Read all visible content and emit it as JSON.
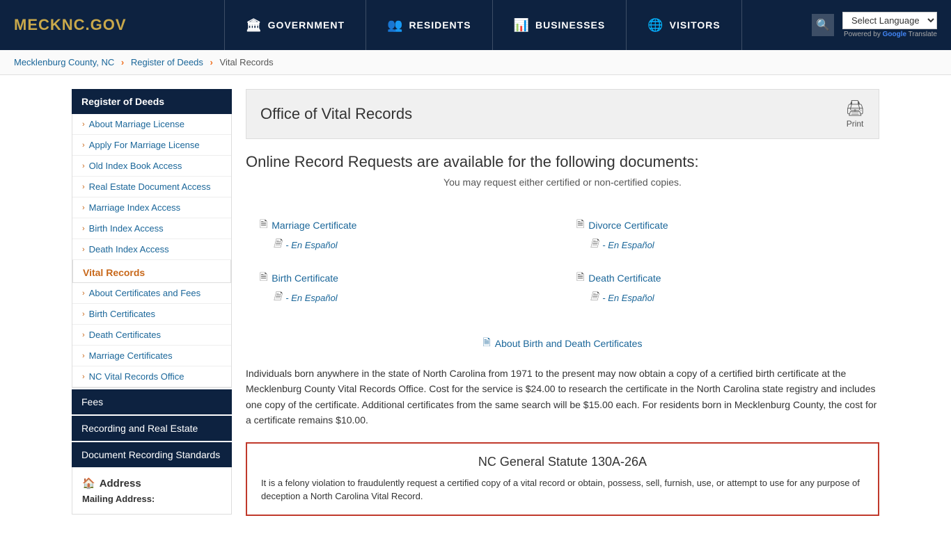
{
  "header": {
    "logo": {
      "prefix": "MECK",
      "suffix": "NC.GOV"
    },
    "nav": [
      {
        "label": "GOVERNMENT",
        "icon": "🏛"
      },
      {
        "label": "RESIDENTS",
        "icon": "👥"
      },
      {
        "label": "BUSINESSES",
        "icon": "📊"
      },
      {
        "label": "VISITORS",
        "icon": "🌐"
      }
    ],
    "translate_label": "Select Language",
    "powered_by": "Powered by",
    "google_text": "Google",
    "translate_text": "Translate"
  },
  "breadcrumb": {
    "items": [
      {
        "label": "Mecklenburg County, NC",
        "href": "#"
      },
      {
        "label": "Register of Deeds",
        "href": "#"
      },
      {
        "label": "Vital Records"
      }
    ]
  },
  "sidebar": {
    "register_header": "Register of Deeds",
    "register_links": [
      {
        "label": "About Marriage License"
      },
      {
        "label": "Apply For Marriage License"
      },
      {
        "label": "Old Index Book Access"
      },
      {
        "label": "Real Estate Document Access"
      },
      {
        "label": "Marriage Index Access"
      },
      {
        "label": "Birth Index Access"
      },
      {
        "label": "Death Index Access"
      }
    ],
    "vital_section": "Vital Records",
    "vital_links": [
      {
        "label": "About Certificates and Fees"
      },
      {
        "label": "Birth Certificates"
      },
      {
        "label": "Death Certificates"
      },
      {
        "label": "Marriage Certificates"
      },
      {
        "label": "NC Vital Records Office"
      }
    ],
    "fees_header": "Fees",
    "recording_header": "Recording and Real Estate",
    "document_header": "Document Recording Standards",
    "address_icon": "🏠",
    "address_title": "Address",
    "mailing_label": "Mailing Address:"
  },
  "content": {
    "title": "Office of Vital Records",
    "print_label": "Print",
    "online_heading": "Online Record Requests are available for the following documents:",
    "online_subtext": "You may request either certified or non-certified copies.",
    "documents": [
      {
        "label": "Marriage Certificate",
        "espanol": "- En Español",
        "col": 0
      },
      {
        "label": "Divorce Certificate",
        "espanol": "- En Español",
        "col": 1
      },
      {
        "label": "Birth Certificate",
        "espanol": "- En Español",
        "col": 0
      },
      {
        "label": "Death Certificate",
        "espanol": "- En Español",
        "col": 1
      }
    ],
    "about_link": "About Birth and Death Certificates",
    "body_text": "Individuals born anywhere in the state of North Carolina from 1971 to the present may now obtain a copy of a certified birth certificate at the Mecklenburg County Vital Records Office. Cost for the service is $24.00 to research the certificate in the North Carolina state registry and includes one copy of the certificate. Additional certificates from the same search will be $15.00 each. For residents born in Mecklenburg County, the cost for a certificate remains $10.00.",
    "statute_title": "NC General Statute 130A-26A",
    "statute_text": "It is a felony violation to fraudulently request a certified copy of a vital record or obtain, possess, sell, furnish, use, or attempt to use for any purpose of deception a North Carolina Vital Record."
  }
}
